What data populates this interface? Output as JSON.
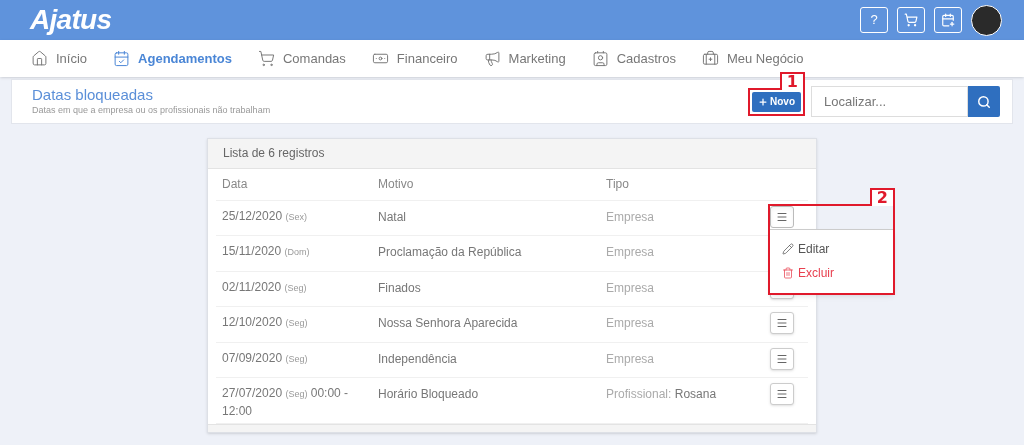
{
  "header": {
    "logo": "Ajatus",
    "help_button": "?"
  },
  "nav": [
    {
      "label": "Início",
      "selected": false
    },
    {
      "label": "Agendamentos",
      "selected": true
    },
    {
      "label": "Comandas",
      "selected": false
    },
    {
      "label": "Financeiro",
      "selected": false
    },
    {
      "label": "Marketing",
      "selected": false
    },
    {
      "label": "Cadastros",
      "selected": false
    },
    {
      "label": "Meu Negócio",
      "selected": false
    }
  ],
  "page": {
    "title": "Datas bloqueadas",
    "subtitle": "Datas em que a empresa ou os profissionais não trabalham",
    "new_button": "Novo",
    "search": {
      "placeholder": "Localizar..."
    }
  },
  "table": {
    "caption": "Lista de 6 registros",
    "columns": [
      "Data",
      "Motivo",
      "Tipo"
    ],
    "rows": [
      {
        "date": "25/12/2020",
        "weekday": "(Sex)",
        "motivo": "Natal",
        "tipo": "Empresa",
        "menu_open": true
      },
      {
        "date": "15/11/2020",
        "weekday": "(Dom)",
        "motivo": "Proclamação da República",
        "tipo": "Empresa",
        "menu_open": false
      },
      {
        "date": "02/11/2020",
        "weekday": "(Seg)",
        "motivo": "Finados",
        "tipo": "Empresa",
        "menu_open": false
      },
      {
        "date": "12/10/2020",
        "weekday": "(Seg)",
        "motivo": "Nossa Senhora Aparecida",
        "tipo": "Empresa",
        "menu_open": false
      },
      {
        "date": "07/09/2020",
        "weekday": "(Seg)",
        "motivo": "Independência",
        "tipo": "Empresa",
        "menu_open": false
      },
      {
        "date": "27/07/2020",
        "weekday": "(Seg)",
        "time": "00:00 - 12:00",
        "motivo": "Horário Bloqueado",
        "tipo": "Profissional:",
        "tipo_name": "Rosana",
        "menu_open": false
      }
    ]
  },
  "row_menu": {
    "items": [
      {
        "kind": "edit",
        "label": "Editar"
      },
      {
        "kind": "delete",
        "label": "Excluir"
      }
    ]
  },
  "annotations": [
    {
      "label": "1"
    },
    {
      "label": "2"
    }
  ]
}
